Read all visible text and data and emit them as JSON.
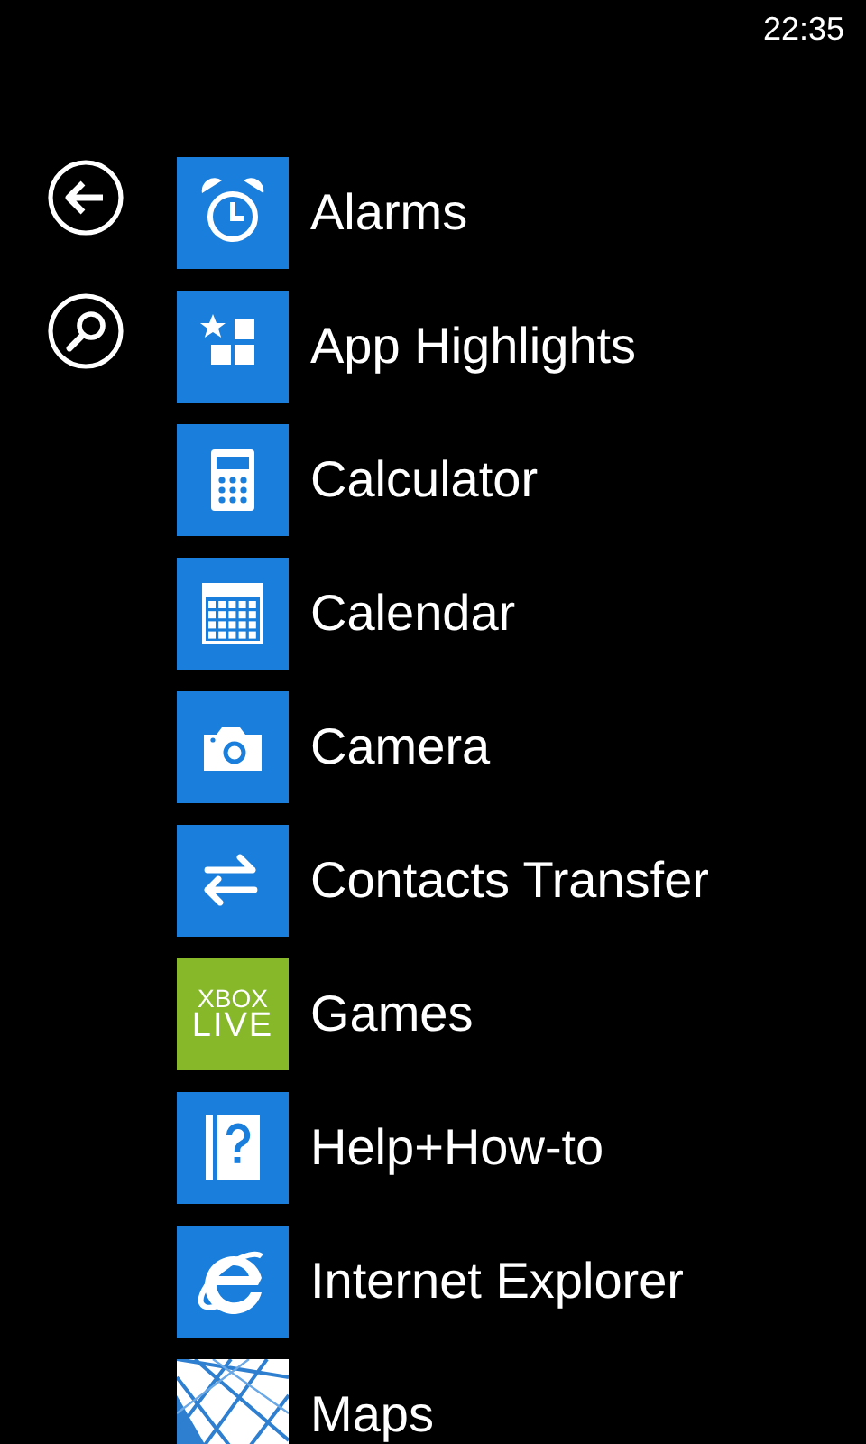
{
  "status_bar": {
    "time": "22:35"
  },
  "side_buttons": [
    {
      "kind": "back"
    },
    {
      "kind": "search"
    }
  ],
  "apps": [
    {
      "label": "Alarms",
      "kind": "alarm",
      "color": "#1a7fdc"
    },
    {
      "label": "App Highlights",
      "kind": "apps",
      "color": "#1a7fdc"
    },
    {
      "label": "Calculator",
      "kind": "calculator",
      "color": "#1a7fdc"
    },
    {
      "label": "Calendar",
      "kind": "calendar",
      "color": "#1a7fdc"
    },
    {
      "label": "Camera",
      "kind": "camera",
      "color": "#1a7fdc"
    },
    {
      "label": "Contacts Transfer",
      "kind": "transfer",
      "color": "#1a7fdc"
    },
    {
      "label": "Games",
      "kind": "xbox",
      "color": "#86b82a",
      "tile_text": [
        "XBOX",
        "LIVE"
      ]
    },
    {
      "label": "Help+How-to",
      "kind": "help",
      "color": "#1a7fdc"
    },
    {
      "label": "Internet Explorer",
      "kind": "browser",
      "color": "#1a7fdc"
    },
    {
      "label": "Maps",
      "kind": "picture"
    }
  ]
}
